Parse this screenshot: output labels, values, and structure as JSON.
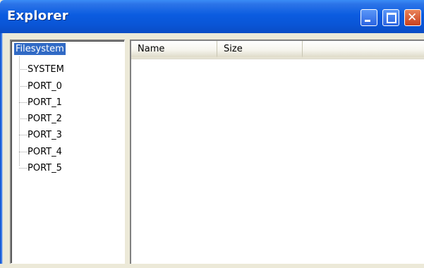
{
  "window": {
    "title": "Explorer",
    "controls": {
      "minimize_icon": "minimize-icon",
      "maximize_icon": "maximize-icon",
      "close_icon": "close-icon",
      "close_glyph": "✕"
    },
    "colors": {
      "titlebar": "#0b5ce0",
      "selection": "#316ac5",
      "close_button": "#c9401e",
      "face": "#ece9d8"
    }
  },
  "tree": {
    "root": {
      "label": "Filesystem",
      "selected": true
    },
    "items": [
      {
        "label": "SYSTEM"
      },
      {
        "label": "PORT_0"
      },
      {
        "label": "PORT_1"
      },
      {
        "label": "PORT_2"
      },
      {
        "label": "PORT_3"
      },
      {
        "label": "PORT_4"
      },
      {
        "label": "PORT_5"
      }
    ]
  },
  "list": {
    "columns": [
      {
        "label": "Name"
      },
      {
        "label": "Size"
      },
      {
        "label": ""
      }
    ],
    "rows": []
  }
}
